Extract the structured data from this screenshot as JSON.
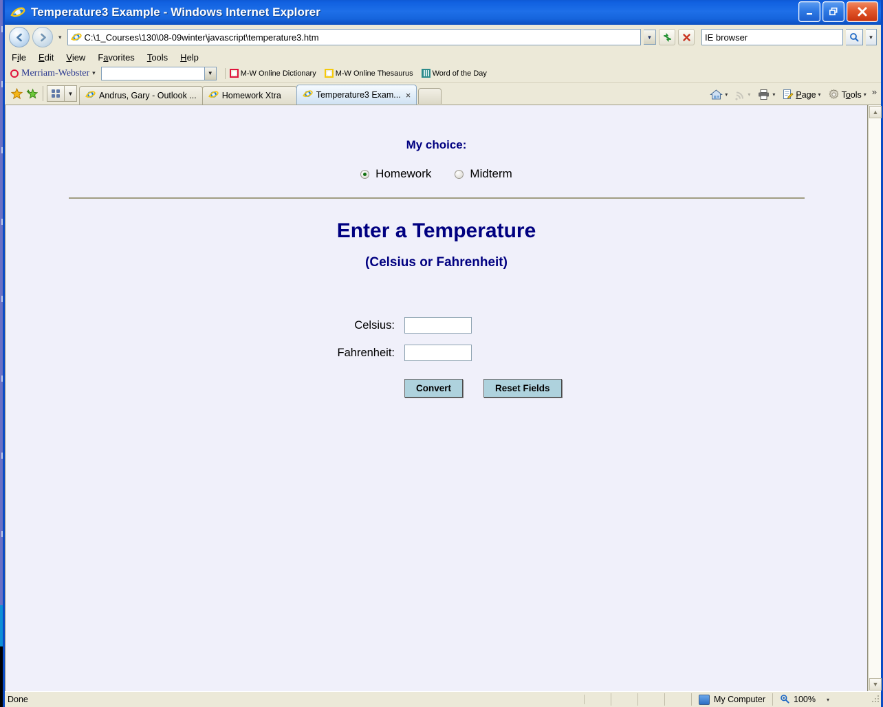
{
  "window": {
    "title": "Temperature3 Example - Windows Internet Explorer",
    "minimize_label": "Minimize",
    "restore_label": "Restore Down",
    "close_label": "Close"
  },
  "address_bar": {
    "back_label": "Back",
    "forward_label": "Forward",
    "recent_pages_label": "Recent Pages",
    "url": "C:\\1_Courses\\130\\08-09winter\\javascript\\temperature3.htm",
    "url_dropdown_label": "Address history",
    "refresh_label": "Refresh",
    "stop_label": "Stop",
    "search_value": "IE browser",
    "search_go_label": "Search",
    "search_options_label": "Search options"
  },
  "menubar": {
    "items": [
      {
        "pre": "F",
        "key": "i",
        "post": "le",
        "label": "File"
      },
      {
        "pre": "",
        "key": "E",
        "post": "dit",
        "label": "Edit"
      },
      {
        "pre": "",
        "key": "V",
        "post": "iew",
        "label": "View"
      },
      {
        "pre": "F",
        "key": "a",
        "post": "vorites",
        "label": "Favorites"
      },
      {
        "pre": "",
        "key": "T",
        "post": "ools",
        "label": "Tools"
      },
      {
        "pre": "",
        "key": "H",
        "post": "elp",
        "label": "Help"
      }
    ]
  },
  "mw_toolbar": {
    "brand": "Merriam-Webster",
    "brand_caret": "▾",
    "search_value": "",
    "links": [
      {
        "label": "M-W Online Dictionary",
        "icon": "red-square-icon"
      },
      {
        "label": "M-W Online Thesaurus",
        "icon": "yellow-square-icon"
      },
      {
        "label": "Word of the Day",
        "icon": "grid-icon"
      }
    ]
  },
  "tabbar": {
    "favorites_label": "Favorites Center",
    "add_favorite_label": "Add to Favorites",
    "quick_tabs_label": "Quick Tabs",
    "tab_list_label": "Tab List",
    "new_tab_label": "New Tab",
    "tabs": [
      {
        "label": "Andrus, Gary - Outlook ...",
        "active": false,
        "closable": false
      },
      {
        "label": "Homework Xtra",
        "active": false,
        "closable": false
      },
      {
        "label": "Temperature3 Exam...",
        "active": true,
        "closable": true,
        "close_glyph": "×"
      }
    ],
    "commands": [
      {
        "label": "",
        "name": "home-button",
        "icon": "home-icon",
        "caret": "▾",
        "disabled": false
      },
      {
        "label": "",
        "name": "feeds-button",
        "icon": "rss-icon",
        "caret": "▾",
        "disabled": true
      },
      {
        "label": "",
        "name": "print-button",
        "icon": "printer-icon",
        "caret": "▾",
        "disabled": false
      },
      {
        "label": "Page",
        "name": "page-button",
        "icon": "page-icon",
        "caret": "▾",
        "disabled": false
      },
      {
        "label": "Tools",
        "name": "tools-button",
        "icon": "gear-icon",
        "caret": "▾",
        "disabled": false
      }
    ],
    "overflow_glyph": "»"
  },
  "page": {
    "my_choice_label": "My choice:",
    "radios": [
      {
        "label": "Homework",
        "checked": true
      },
      {
        "label": "Midterm",
        "checked": false
      }
    ],
    "heading": "Enter a Temperature",
    "subheading": "(Celsius or Fahrenheit)",
    "fields": [
      {
        "label": "Celsius:",
        "value": "",
        "name": "celsius-input"
      },
      {
        "label": "Fahrenheit:",
        "value": "",
        "name": "fahrenheit-input"
      }
    ],
    "buttons": [
      {
        "label": "Convert",
        "name": "convert-button"
      },
      {
        "label": "Reset Fields",
        "name": "reset-fields-button"
      }
    ],
    "colors": {
      "background": "#f0f0fa",
      "heading": "#000080",
      "button": "#aed2dd"
    }
  },
  "scrollbar": {
    "up_glyph": "▲",
    "down_glyph": "▼"
  },
  "statusbar": {
    "status": "Done",
    "zone": "My Computer",
    "zoom": "100%",
    "zoom_caret": "▾",
    "zoom_icon": "magnifier-plus-icon"
  }
}
